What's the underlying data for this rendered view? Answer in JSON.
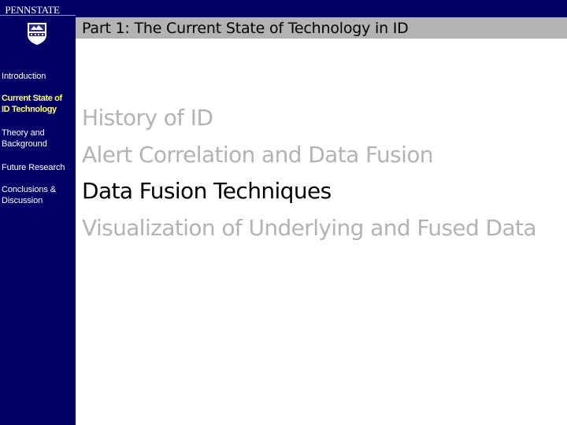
{
  "branding": {
    "logo_text": "PENNSTATE",
    "shield_icon": "penn-state-shield-icon",
    "shield_year": "1855"
  },
  "header": {
    "title": "Part 1: The Current State of Technology in ID"
  },
  "sidebar": {
    "items": [
      {
        "label": "Introduction",
        "active": false
      },
      {
        "label": "Current State of ID Technology",
        "line1": "Current State of",
        "line2": "ID Technology",
        "active": true
      },
      {
        "label": "Theory and Background",
        "line1": "Theory and",
        "line2": "Background",
        "active": false
      },
      {
        "label": "Future Research",
        "active": false
      },
      {
        "label": "Conclusions & Discussion",
        "line1": "Conclusions &",
        "line2": "Discussion",
        "active": false
      }
    ]
  },
  "main": {
    "bullets": [
      {
        "text": "History of ID",
        "state": "dimmed"
      },
      {
        "text": "Alert Correlation and Data Fusion",
        "state": "dimmed"
      },
      {
        "text": "Data Fusion Techniques",
        "state": "current"
      },
      {
        "text": "Visualization of Underlying and Fused Data",
        "state": "dimmed"
      }
    ]
  },
  "colors": {
    "sidebar_bg": "#000066",
    "title_bar_bg": "#b3b3b3",
    "active_nav": "#ffff66",
    "inactive_nav": "#ffffff",
    "dimmed_bullet": "#b3b3b3",
    "current_bullet": "#000000"
  }
}
